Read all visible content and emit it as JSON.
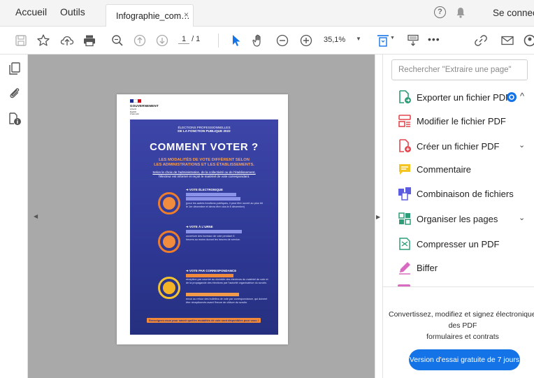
{
  "tabbar": {
    "home": "Accueil",
    "tools": "Outils",
    "tab_label": "Infographie_com…",
    "tab_close": "×",
    "sign_in": "Se connecter"
  },
  "toolbar": {
    "page_current": "1",
    "page_total": "/ 1",
    "zoom": "35,1%",
    "more": "•••"
  },
  "search": {
    "placeholder": "Rechercher \"Extraire une page\""
  },
  "tools": [
    {
      "label": "Exporter un fichier PDF",
      "icon": "export-pdf-icon",
      "expanded": true
    },
    {
      "label": "Modifier le fichier PDF",
      "icon": "edit-pdf-icon"
    },
    {
      "label": "Créer un fichier PDF",
      "icon": "create-pdf-icon",
      "expandable": true
    },
    {
      "label": "Commentaire",
      "icon": "comment-icon"
    },
    {
      "label": "Combinaison de fichiers",
      "icon": "combine-files-icon"
    },
    {
      "label": "Organiser les pages",
      "icon": "organize-pages-icon",
      "expandable": true
    },
    {
      "label": "Compresser un PDF",
      "icon": "compress-pdf-icon"
    },
    {
      "label": "Biffer",
      "icon": "redact-icon"
    }
  ],
  "promo": {
    "line1": "Convertissez, modifiez et signez électroniquement",
    "line2": "des PDF",
    "line3": "formulaires et contrats",
    "button": "Version d'essai gratuite de 7 jours"
  },
  "poster": {
    "gov_name": "GOUVERNEMENT",
    "gov_motto": [
      "Liberté",
      "Égalité",
      "Fraternité"
    ],
    "kicker_1": "ÉLECTIONS PROFESSIONNELLES",
    "kicker_2": "DE LA FONCTION PUBLIQUE 2022",
    "title": "COMMENT VOTER ?",
    "subtitle_1": "LES MODALITÉS DE VOTE DIFFÈRENT SELON",
    "subtitle_2": "LES ADMINISTRATIONS ET LES ÉTABLISSEMENTS.",
    "intro_1": "Selon le choix de l'administration, de la collectivité ou de l'établissement,",
    "intro_2": "l'électeur est informé et reçoit le matériel de vote correspondant.",
    "vote1": "➔ VOTE ÉLECTRONIQUE",
    "vote1_desc": "(pour les autres fonctions publiques, il peut être ouvert au plus tôt le 1er décembre et devra être clos le 8 décembre)",
    "vote2": "➔ VOTE À L'URNE",
    "vote2_desc": "ouverture des bureaux de vote pendant 6 heures au moins durant les heures de service.",
    "vote3": "➔ VOTE PAR CORRESPONDANCE",
    "vote3_desc1": "réception par courrier au domicile des électeurs du matériel de vote et de la propagande des élections par l'autorité organisatrice du scrutin.",
    "vote3_desc2": "envoi au retour des bulletins de vote par correspondance, qui doivent être réceptionnés avant l'heure de clôture du scrutin.",
    "footer": "Renseignez-vous pour savoir quelles modalités de vote sont disponibles pour vous !"
  },
  "colors": {
    "accent_blue": "#1473e6",
    "poster_blue": "#2e3894",
    "poster_orange": "#f08a3a",
    "doc_gray": "#a9a9a9"
  }
}
